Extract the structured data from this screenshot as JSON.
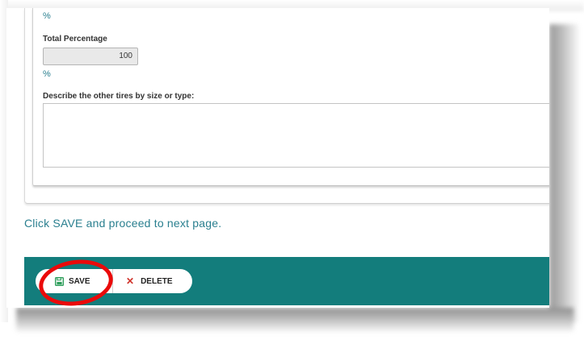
{
  "form": {
    "unit_top": "%",
    "total_percentage_label": "Total Percentage",
    "total_percentage_value": "100",
    "unit_bottom": "%",
    "describe_label": "Describe the other tires by size or type:",
    "describe_value": ""
  },
  "instruction_text": "Click SAVE and proceed to next page.",
  "footer": {
    "save_label": "SAVE",
    "save_icon": "floppy-disk-icon",
    "delete_label": "DELETE",
    "delete_icon": "x-icon",
    "delete_glyph": "✕"
  },
  "colors": {
    "accent": "#137d7c",
    "link_text": "#2a7f8f",
    "highlight": "#ea0a0a",
    "delete_icon": "#d0342c",
    "save_icon": "#2e9e5b"
  }
}
